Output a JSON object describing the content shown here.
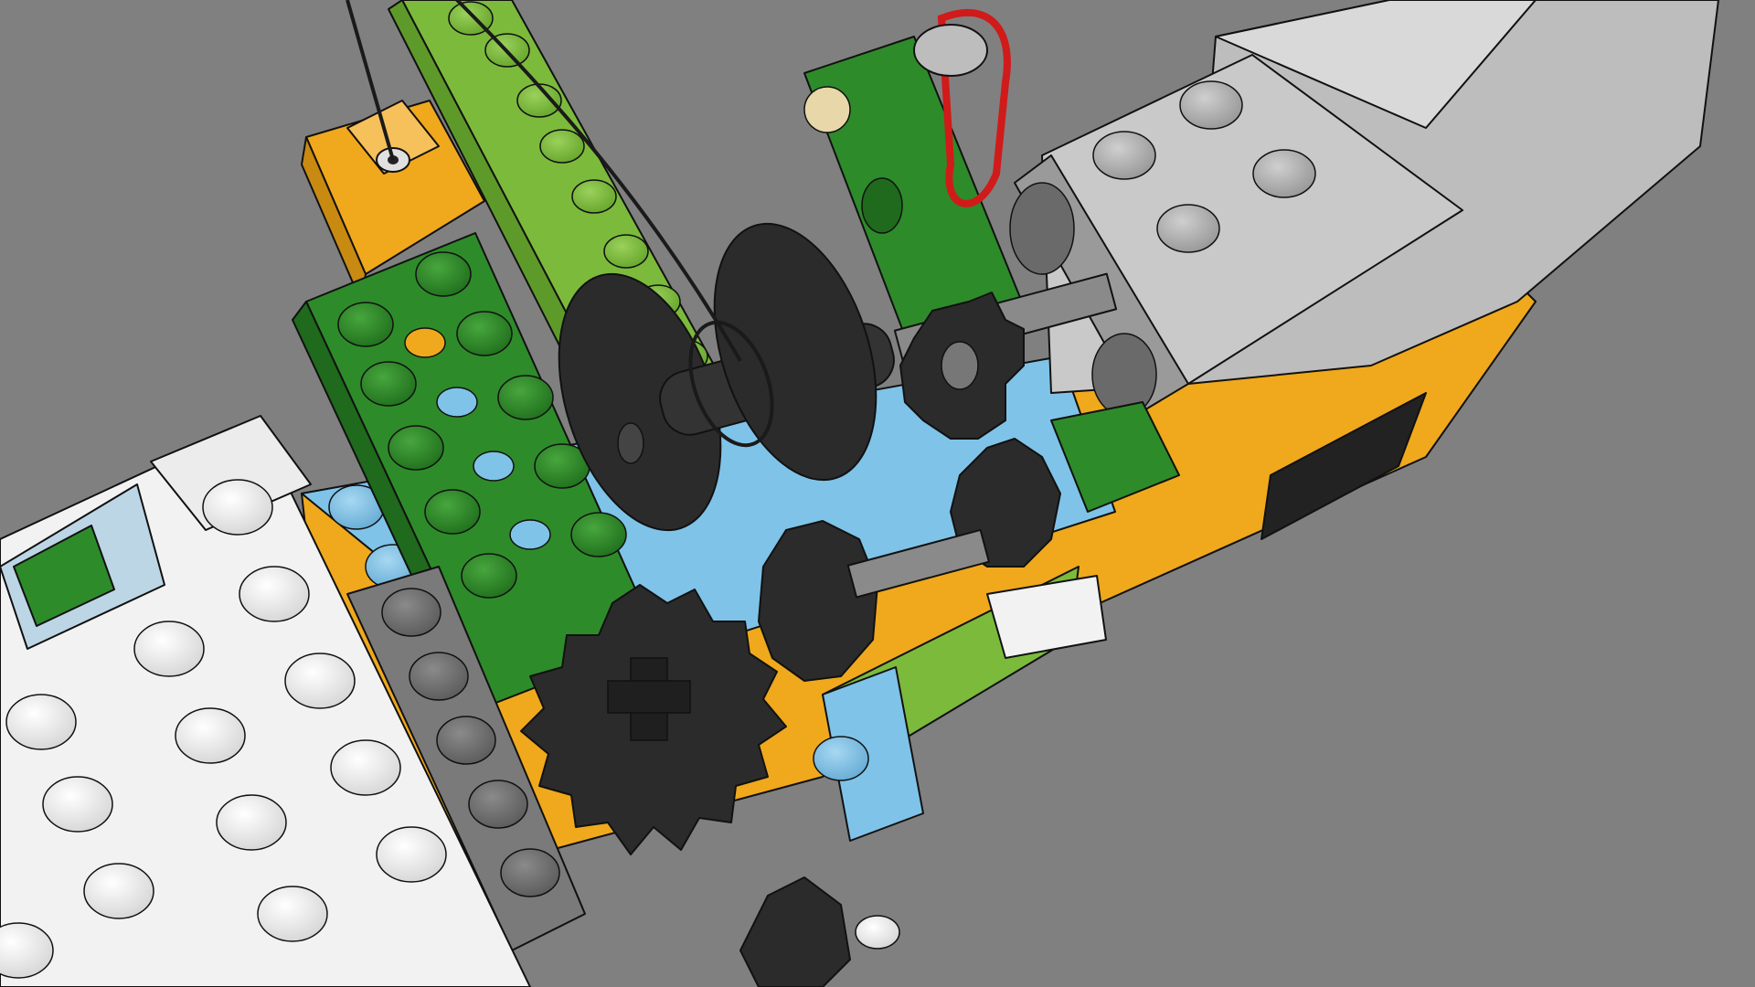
{
  "scene": {
    "background_color": "#808080",
    "subject": "lego-gear-mechanism",
    "colors": {
      "lego_green": "#2e8b2a",
      "lime_green": "#7cba3c",
      "yellow_orange": "#f0a81c",
      "sky_blue": "#7fc3e8",
      "white": "#f2f2f2",
      "light_gray": "#bdbdbd",
      "dark_gray": "#7a7a7a",
      "gear_black": "#2b2b2b",
      "rubber_band_red": "#d11a1a",
      "string_black": "#1a1a1a",
      "tan": "#e8d7a8"
    },
    "parts": [
      "white-plate",
      "blue-brick",
      "green-technic-brick",
      "lime-beam",
      "orange-brick",
      "pulley-wheel",
      "black-gear-small",
      "black-gear-large",
      "motor-housing",
      "rubber-band",
      "string",
      "axle"
    ]
  }
}
